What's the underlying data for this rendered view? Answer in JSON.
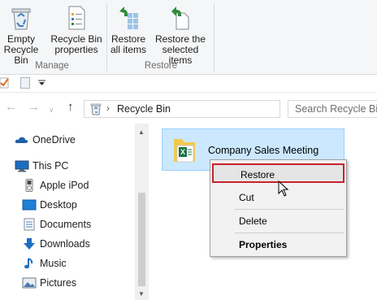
{
  "ribbon": {
    "manage_group": {
      "label": "Manage",
      "empty_bin": [
        "Empty",
        "Recycle Bin"
      ],
      "bin_properties": [
        "Recycle Bin",
        "properties"
      ]
    },
    "restore_group": {
      "label": "Restore",
      "restore_all": [
        "Restore",
        "all items"
      ],
      "restore_selected": [
        "Restore the",
        "selected items"
      ]
    }
  },
  "address_bar": {
    "path": "Recycle Bin",
    "search_placeholder": "Search Recycle Bin"
  },
  "nav_pane": {
    "items": [
      {
        "label": "OneDrive",
        "icon": "cloud-icon"
      },
      {
        "label": "This PC",
        "icon": "computer-icon"
      },
      {
        "label": "Apple iPod",
        "icon": "ipod-icon"
      },
      {
        "label": "Desktop",
        "icon": "desktop-icon"
      },
      {
        "label": "Documents",
        "icon": "documents-icon"
      },
      {
        "label": "Downloads",
        "icon": "download-arrow-icon"
      },
      {
        "label": "Music",
        "icon": "music-note-icon"
      },
      {
        "label": "Pictures",
        "icon": "pictures-icon"
      }
    ]
  },
  "content": {
    "file_name": "Company Sales Meeting"
  },
  "context_menu": {
    "items": [
      "Restore",
      "Cut",
      "Delete",
      "Properties"
    ]
  },
  "colors": {
    "selection_bg": "#cce8ff",
    "selection_border": "#99d1ff",
    "highlight_border": "#c8232c",
    "restore_green": "#2e8b3c",
    "folder_yellow": "#f4c84a",
    "excel_green": "#1e7145"
  }
}
